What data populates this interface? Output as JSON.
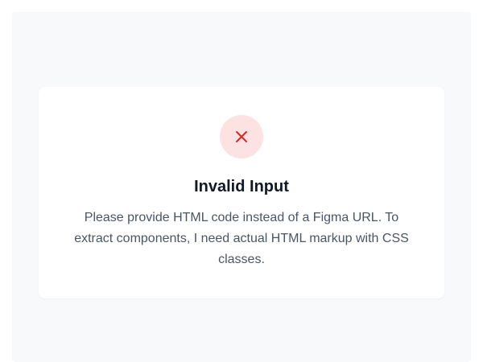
{
  "error": {
    "icon": "close-icon",
    "icon_color": "#dc2626",
    "icon_background": "#fde2e2",
    "title": "Invalid Input",
    "message": "Please provide HTML code instead of a Figma URL. To extract components, I need actual HTML markup with CSS classes."
  }
}
